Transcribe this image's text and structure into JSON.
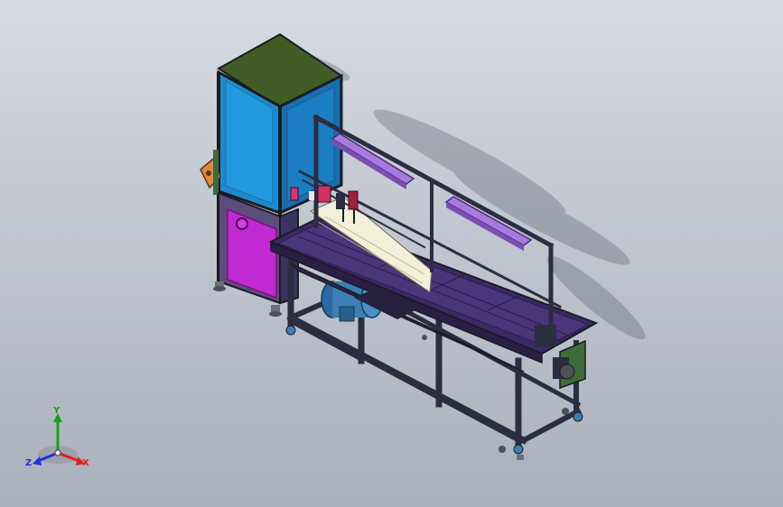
{
  "viewport": {
    "background_top": "#d7dbe2",
    "background_bottom": "#aab0bb"
  },
  "model": {
    "colors": {
      "cabinet_glass": "#1e8ad0",
      "cabinet_top": "#3f5d25",
      "lower_panel": "#c02ad0",
      "light_bars": "#a77bdd",
      "motor": "#3c7fb5",
      "frame": "#2b2d40",
      "conveyor": "#3b2a63",
      "track_light": "#f2f0d8",
      "side_guard": "#e08a3a",
      "gear_box": "#3d6b3a"
    }
  },
  "triad": {
    "x_label": "X",
    "y_label": "Y",
    "z_label": "Z",
    "x_color": "#e02020",
    "y_color": "#18a018",
    "z_color": "#2030e0"
  }
}
